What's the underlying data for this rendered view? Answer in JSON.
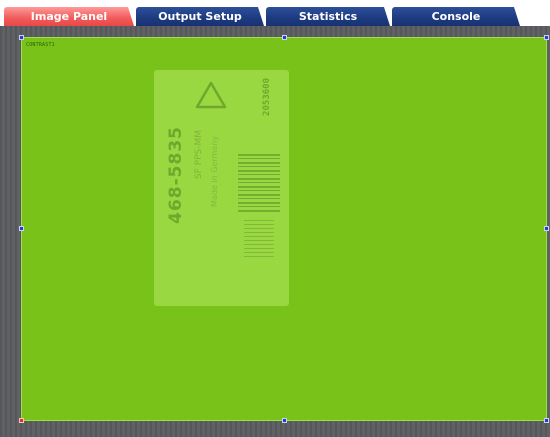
{
  "tabs": [
    {
      "label": "Image Panel",
      "active": true
    },
    {
      "label": "Output Setup",
      "active": false
    },
    {
      "label": "Statistics",
      "active": false
    },
    {
      "label": "Console",
      "active": false
    }
  ],
  "roi": {
    "label": "CONTRAST1",
    "color": "#78c21a"
  },
  "sticker": {
    "icon": "triangle-recycle-icon",
    "side_code": "2053600",
    "part_number": "468-5835",
    "line1": "SF PPS-MM",
    "line2": "Made in Germany"
  },
  "colors": {
    "active_tab": "#f05a5a",
    "inactive_tab": "#1d3a80",
    "handle": "#2b40b8",
    "anchor_handle": "#d23a2a",
    "background": "#5b5c60"
  }
}
